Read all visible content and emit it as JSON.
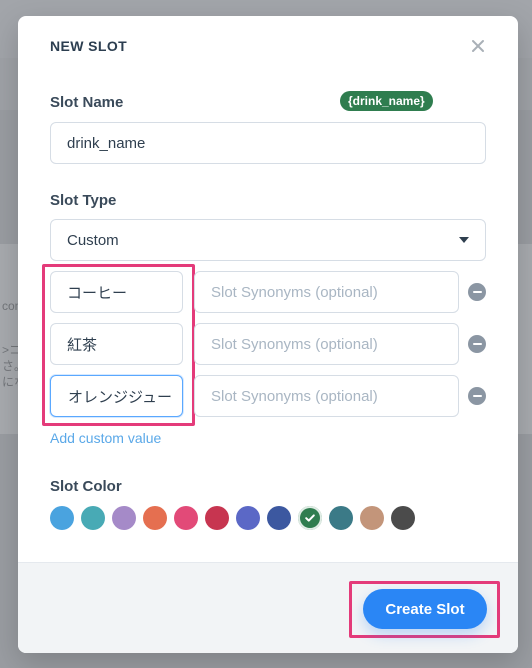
{
  "background": {
    "left_snippets": [
      "con",
      ">コ",
      "さ。",
      "にな"
    ]
  },
  "modal": {
    "title": "NEW SLOT",
    "close_icon": "close-icon",
    "slot_name_label": "Slot Name",
    "slot_name_value": "drink_name",
    "slot_name_pill": "{drink_name}",
    "slot_type_label": "Slot Type",
    "slot_type_value": "Custom",
    "values": [
      {
        "value": "コーヒー",
        "synonyms_placeholder": "Slot Synonyms (optional)"
      },
      {
        "value": "紅茶",
        "synonyms_placeholder": "Slot Synonyms (optional)"
      },
      {
        "value": "オレンジジュー",
        "synonyms_placeholder": "Slot Synonyms (optional)"
      }
    ],
    "add_custom_value": "Add custom value",
    "slot_color_label": "Slot Color",
    "colors": [
      "#4aa3df",
      "#48aab5",
      "#a58ac8",
      "#e56f50",
      "#e24a78",
      "#c73550",
      "#5b68c6",
      "#3c58a0",
      "#2f7d4f",
      "#3b7a87",
      "#c3957a",
      "#4b4b4b"
    ],
    "selected_color_index": 8,
    "create_button": "Create Slot"
  }
}
